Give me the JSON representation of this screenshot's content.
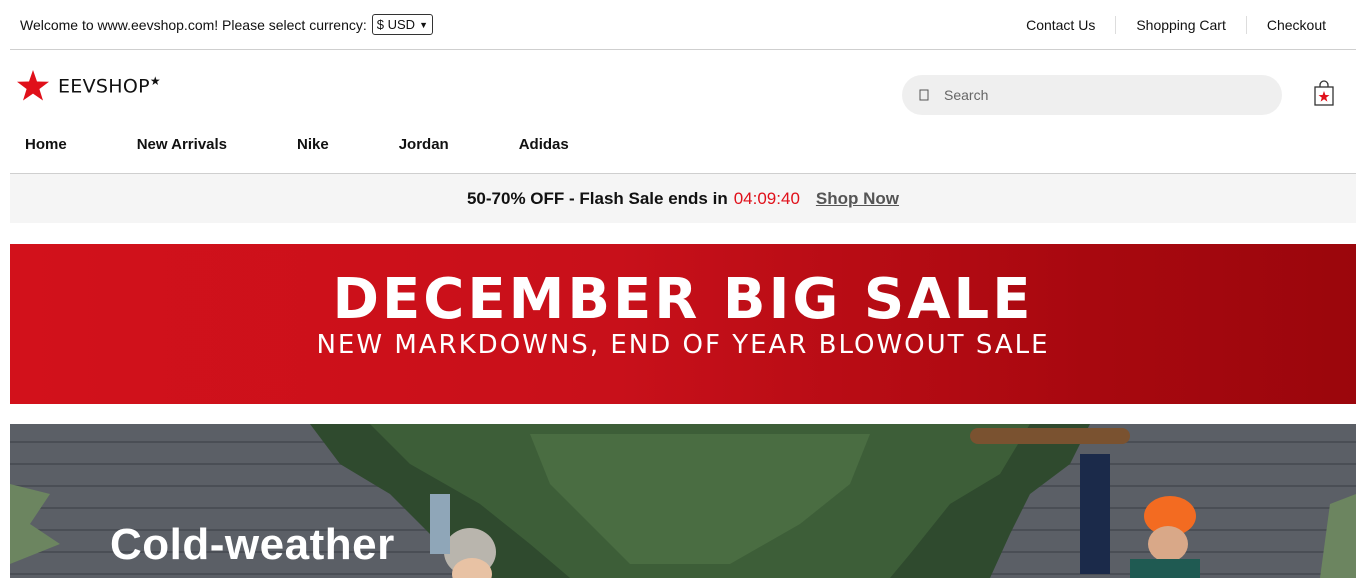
{
  "topbar": {
    "welcome_text": "Welcome to www.eevshop.com! Please select currency:",
    "currency_selected": "$ USD",
    "links": [
      "Contact Us",
      "Shopping Cart",
      "Checkout"
    ]
  },
  "header": {
    "logo_text": "EEVSHOP",
    "logo_mark": "★",
    "search_placeholder": "Search",
    "cart_icon": "shopping-bag-icon"
  },
  "nav": {
    "items": [
      "Home",
      "New Arrivals",
      "Nike",
      "Jordan",
      "Adidas"
    ]
  },
  "promo": {
    "text": "50-70% OFF - Flash Sale ends in",
    "timer": "04:09:40",
    "link": "Shop Now"
  },
  "banner": {
    "title": "DECEMBER BIG SALE",
    "subtitle": "NEW MARKDOWNS, END OF YEAR BLOWOUT SALE"
  },
  "hero": {
    "headline": "Cold-weather"
  },
  "colors": {
    "brand_red": "#e0101a",
    "banner_red": "#c8101a"
  }
}
